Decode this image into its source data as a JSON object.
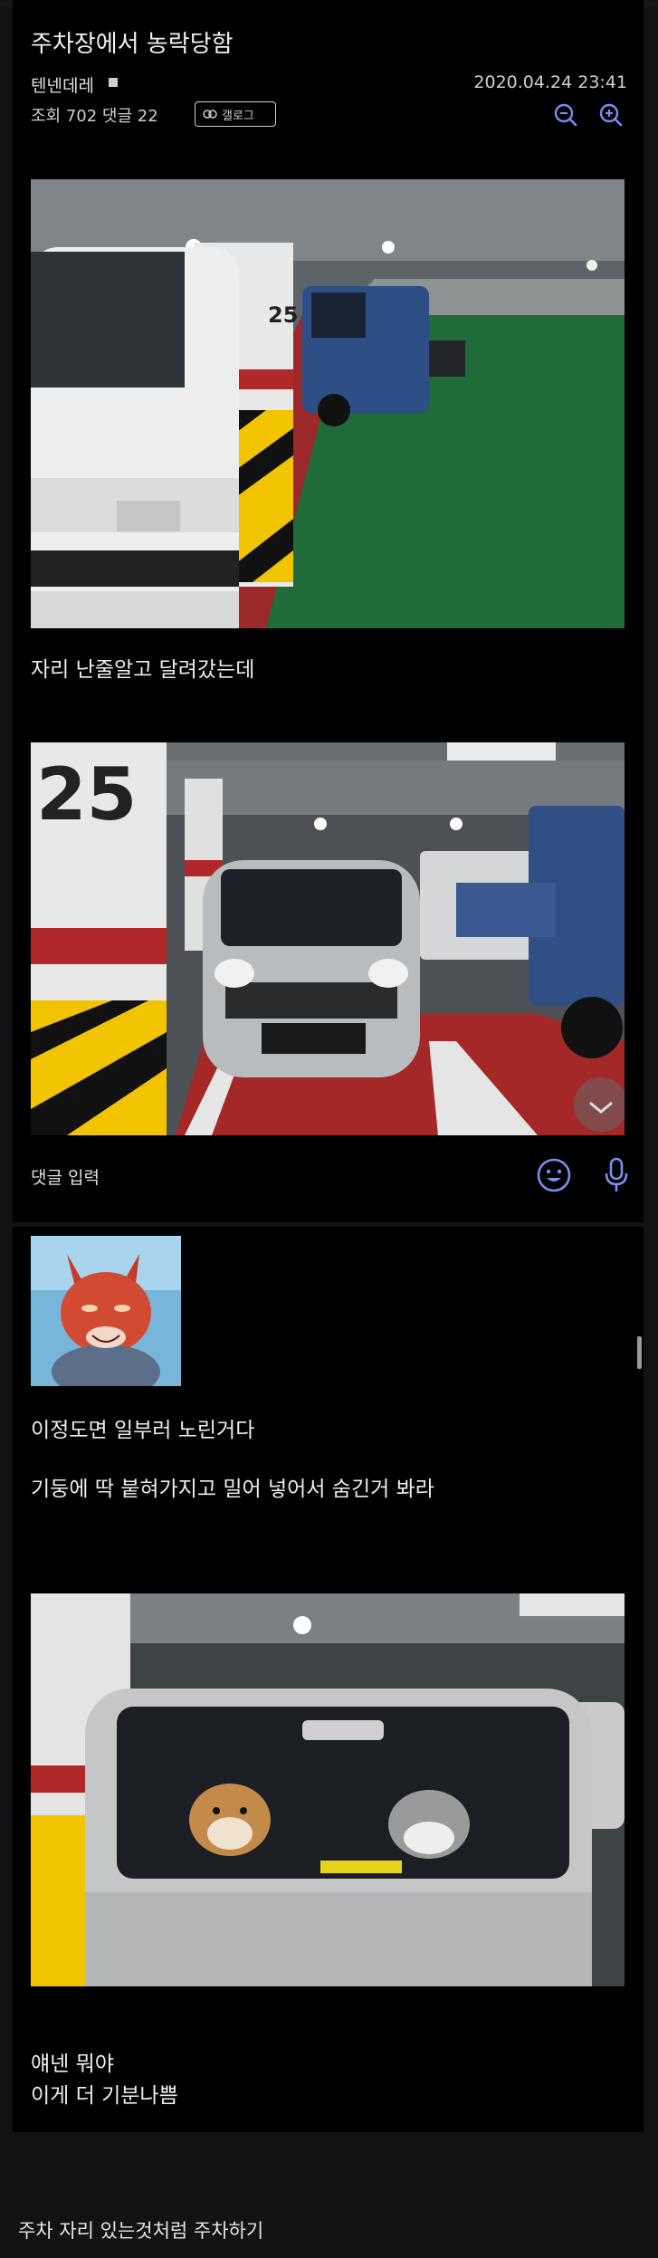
{
  "post": {
    "title": "주차장에서 농락당함",
    "author": "텐넨데레",
    "date": "2020.04.24 23:41",
    "stats": "조회 702 댓글 22",
    "gallery_button": "갤로그"
  },
  "images": {
    "photo1_caption": "자리 난줄알고 달려갔는데",
    "photo1_pillar_number": "25",
    "photo2_pillar_number": "25"
  },
  "comment_bar": {
    "placeholder": "댓글 입력"
  },
  "comment": {
    "line1": "이정도면 일부러 노린거다",
    "line2": "기둥에 딱 붙혀가지고 밀어 넣어서 숨긴거 봐라",
    "line3": "얘넨 뭐야",
    "line4": "이게 더 기분나쁨"
  },
  "footer": {
    "caption": "주차 자리 있는것처럼 주차하기"
  },
  "colors": {
    "background": "#000000",
    "page": "#111213",
    "accent_icon": "#7a8ef0"
  }
}
